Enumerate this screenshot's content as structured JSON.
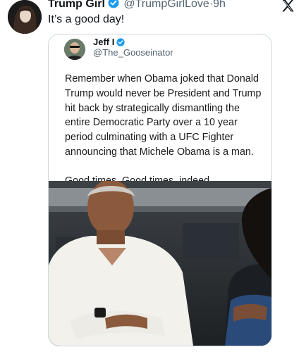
{
  "post": {
    "author_name": "Trump Girl",
    "author_handle": "@TrumpGirlLove",
    "separator": "·",
    "time": "9h",
    "text": "It’s a good day!"
  },
  "quoted": {
    "author_name": "Jeff I",
    "author_handle": "@The_Gooseinator",
    "body": "Remember when Obama joked that Donald Trump would never be President and Trump hit back by strategically dismantling the entire Democratic Party over a 10 year period culminating with a UFC Fighter announcing that Michele Obama is a man.",
    "closing": "Good times. Good times, indeed."
  },
  "icons": {
    "verified": "verified-badge-icon",
    "x_logo": "x-logo-icon"
  },
  "colors": {
    "verified": "#1d9bf0",
    "muted_text": "#536471",
    "border": "#cfd9de"
  }
}
